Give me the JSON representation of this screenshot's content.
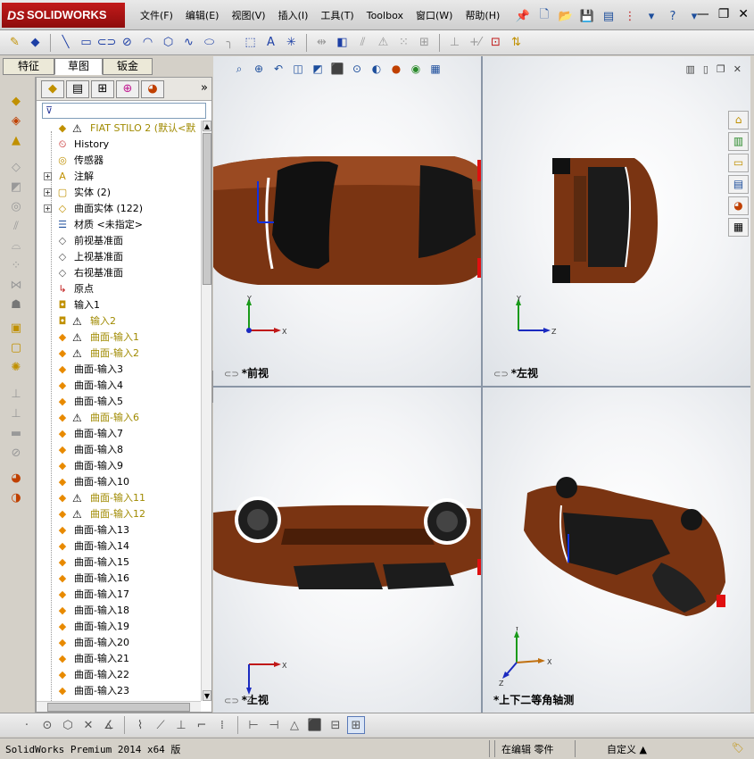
{
  "app": {
    "logo": "SOLIDWORKS",
    "logo_prefix": "DS"
  },
  "menu": [
    "文件(F)",
    "编辑(E)",
    "视图(V)",
    "插入(I)",
    "工具(T)",
    "Toolbox",
    "窗口(W)",
    "帮助(H)"
  ],
  "command_tabs": [
    "特征",
    "草图",
    "钣金"
  ],
  "feature_tree": {
    "filter_placeholder": "",
    "more_label": "»",
    "items": [
      {
        "label": "FIAT STILO 2  (默认<默",
        "icon": "part",
        "warning": true,
        "expandable": false,
        "yellow": true
      },
      {
        "label": "History",
        "icon": "history",
        "warning": false,
        "expandable": false,
        "yellow": false
      },
      {
        "label": "传感器",
        "icon": "sensor",
        "warning": false,
        "expandable": false,
        "yellow": false
      },
      {
        "label": "注解",
        "icon": "annotation",
        "warning": false,
        "expandable": true,
        "yellow": false
      },
      {
        "label": "实体 (2)",
        "icon": "solid-bodies",
        "warning": false,
        "expandable": true,
        "yellow": false
      },
      {
        "label": "曲面实体 (122)",
        "icon": "surface-bodies",
        "warning": false,
        "expandable": true,
        "yellow": false
      },
      {
        "label": "材质 <未指定>",
        "icon": "material",
        "warning": false,
        "expandable": false,
        "yellow": false
      },
      {
        "label": "前视基准面",
        "icon": "plane",
        "warning": false,
        "expandable": false,
        "yellow": false
      },
      {
        "label": "上视基准面",
        "icon": "plane",
        "warning": false,
        "expandable": false,
        "yellow": false
      },
      {
        "label": "右视基准面",
        "icon": "plane",
        "warning": false,
        "expandable": false,
        "yellow": false
      },
      {
        "label": "原点",
        "icon": "origin",
        "warning": false,
        "expandable": false,
        "yellow": false
      },
      {
        "label": "输入1",
        "icon": "import",
        "warning": false,
        "expandable": false,
        "yellow": false
      },
      {
        "label": "输入2",
        "icon": "import",
        "warning": true,
        "expandable": false,
        "yellow": true
      },
      {
        "label": "曲面-输入1",
        "icon": "surface-import",
        "warning": true,
        "expandable": false,
        "yellow": true
      },
      {
        "label": "曲面-输入2",
        "icon": "surface-import",
        "warning": true,
        "expandable": false,
        "yellow": true
      },
      {
        "label": "曲面-输入3",
        "icon": "surface-import",
        "warning": false,
        "expandable": false,
        "yellow": false
      },
      {
        "label": "曲面-输入4",
        "icon": "surface-import",
        "warning": false,
        "expandable": false,
        "yellow": false
      },
      {
        "label": "曲面-输入5",
        "icon": "surface-import",
        "warning": false,
        "expandable": false,
        "yellow": false
      },
      {
        "label": "曲面-输入6",
        "icon": "surface-import",
        "warning": true,
        "expandable": false,
        "yellow": true
      },
      {
        "label": "曲面-输入7",
        "icon": "surface-import",
        "warning": false,
        "expandable": false,
        "yellow": false
      },
      {
        "label": "曲面-输入8",
        "icon": "surface-import",
        "warning": false,
        "expandable": false,
        "yellow": false
      },
      {
        "label": "曲面-输入9",
        "icon": "surface-import",
        "warning": false,
        "expandable": false,
        "yellow": false
      },
      {
        "label": "曲面-输入10",
        "icon": "surface-import",
        "warning": false,
        "expandable": false,
        "yellow": false
      },
      {
        "label": "曲面-输入11",
        "icon": "surface-import",
        "warning": true,
        "expandable": false,
        "yellow": true
      },
      {
        "label": "曲面-输入12",
        "icon": "surface-import",
        "warning": true,
        "expandable": false,
        "yellow": true
      },
      {
        "label": "曲面-输入13",
        "icon": "surface-import",
        "warning": false,
        "expandable": false,
        "yellow": false
      },
      {
        "label": "曲面-输入14",
        "icon": "surface-import",
        "warning": false,
        "expandable": false,
        "yellow": false
      },
      {
        "label": "曲面-输入15",
        "icon": "surface-import",
        "warning": false,
        "expandable": false,
        "yellow": false
      },
      {
        "label": "曲面-输入16",
        "icon": "surface-import",
        "warning": false,
        "expandable": false,
        "yellow": false
      },
      {
        "label": "曲面-输入17",
        "icon": "surface-import",
        "warning": false,
        "expandable": false,
        "yellow": false
      },
      {
        "label": "曲面-输入18",
        "icon": "surface-import",
        "warning": false,
        "expandable": false,
        "yellow": false
      },
      {
        "label": "曲面-输入19",
        "icon": "surface-import",
        "warning": false,
        "expandable": false,
        "yellow": false
      },
      {
        "label": "曲面-输入20",
        "icon": "surface-import",
        "warning": false,
        "expandable": false,
        "yellow": false
      },
      {
        "label": "曲面-输入21",
        "icon": "surface-import",
        "warning": false,
        "expandable": false,
        "yellow": false
      },
      {
        "label": "曲面-输入22",
        "icon": "surface-import",
        "warning": false,
        "expandable": false,
        "yellow": false
      },
      {
        "label": "曲面-输入23",
        "icon": "surface-import",
        "warning": false,
        "expandable": false,
        "yellow": false
      }
    ]
  },
  "viewports": [
    {
      "name": "*前视",
      "axes": [
        "Y",
        "X"
      ]
    },
    {
      "name": "*左视",
      "axes": [
        "Y",
        "Z"
      ]
    },
    {
      "name": "*上视",
      "axes": [
        "X",
        "Z"
      ]
    },
    {
      "name": "*上下二等角轴测",
      "axes": [
        "Y",
        "X",
        "Z"
      ]
    }
  ],
  "status": {
    "product": "SolidWorks Premium 2014 x64 版",
    "mode": "在编辑 零件",
    "units": "自定义"
  },
  "colors": {
    "car_body": "#7a3412",
    "accent_red": "#c21a1a",
    "warning_yellow": "#a08a00"
  }
}
